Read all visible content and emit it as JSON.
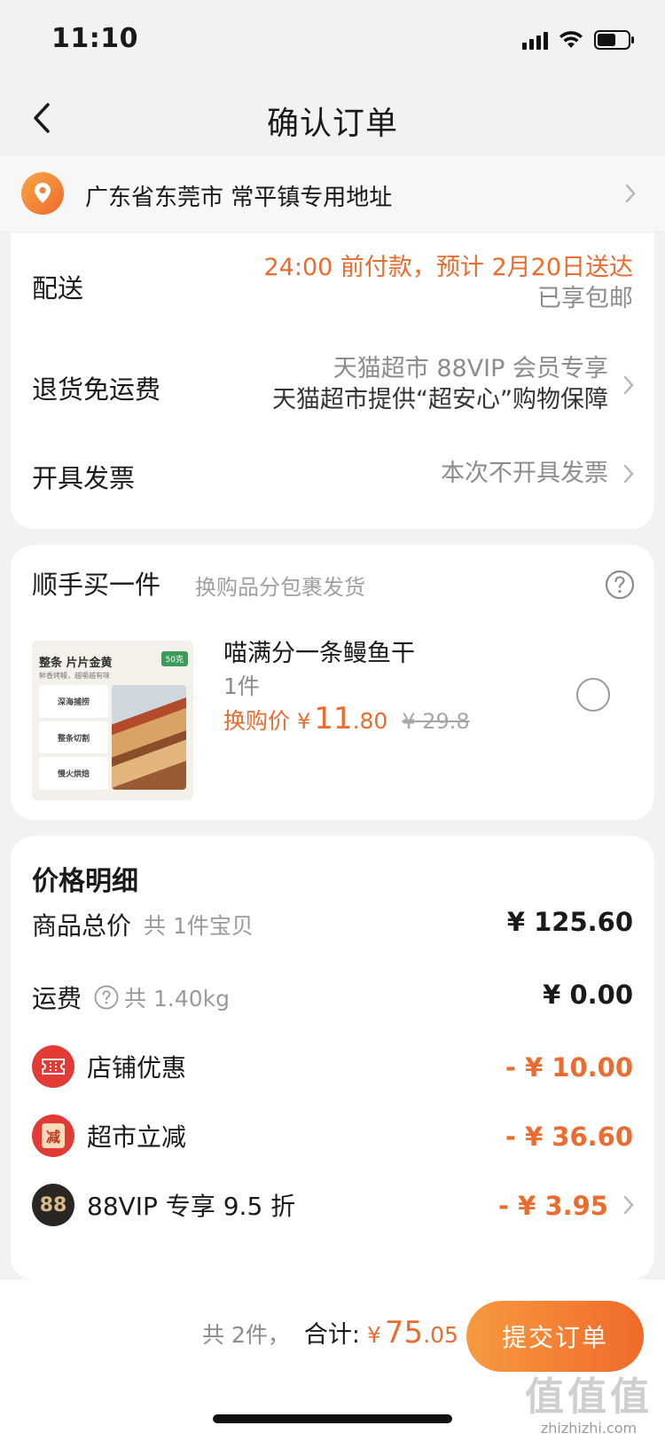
{
  "status_bar": {
    "time": "11:10"
  },
  "navbar": {
    "title": "确认订单"
  },
  "address": {
    "text": "广东省东莞市 常平镇专用地址"
  },
  "delivery": {
    "label": "配送",
    "line1": "24:00 前付款，预计 2月20日送达",
    "line2": "已享包邮"
  },
  "return_shipping": {
    "label": "退货免运费",
    "line1": "天猫超市 88VIP 会员专享",
    "line2": "天猫超市提供“超安心”购物保障"
  },
  "invoice": {
    "label": "开具发票",
    "value": "本次不开具发票"
  },
  "addon": {
    "title": "顺手买一件",
    "subtitle": "换购品分包裹发货",
    "product": {
      "image_title": "整条 片片金黄",
      "image_badge": "50克",
      "image_sub": "鲜香烤鳗，越嚼越有味",
      "image_steps": [
        "深海捕捞",
        "整条切割",
        "慢火烘焙"
      ],
      "name": "喵满分一条鳗鱼干",
      "qty": "1件",
      "price_label": "换购价",
      "currency": "¥",
      "price_int": "11",
      "price_dec": ".80",
      "orig_price": "¥ 29.8"
    }
  },
  "price_detail": {
    "title": "价格明细",
    "rows": [
      {
        "label": "商品总价",
        "sub": "共 1件宝贝",
        "value": "¥ 125.60"
      },
      {
        "label": "运费",
        "sub": "共 1.40kg",
        "value": "¥ 0.00"
      },
      {
        "label": "店铺优惠",
        "value": "- ¥ 10.00"
      },
      {
        "label": "超市立减",
        "value": "- ¥ 36.60"
      },
      {
        "label": "88VIP 专享 9.5 折",
        "value": "- ¥ 3.95"
      }
    ],
    "icon_labels": {
      "reduce": "减",
      "vip": "88"
    }
  },
  "bottom": {
    "count": "共 2件，",
    "total_label": "合计:",
    "currency": "¥",
    "total_int": "75",
    "total_dec": ".05",
    "submit": "提交订单"
  },
  "watermark": {
    "glyphs": "值值值",
    "url": "zhizhizhi.com"
  },
  "colors": {
    "accent": "#ea6c2f",
    "promo_red": "#e23b36",
    "vip_dark": "#2a2624"
  }
}
